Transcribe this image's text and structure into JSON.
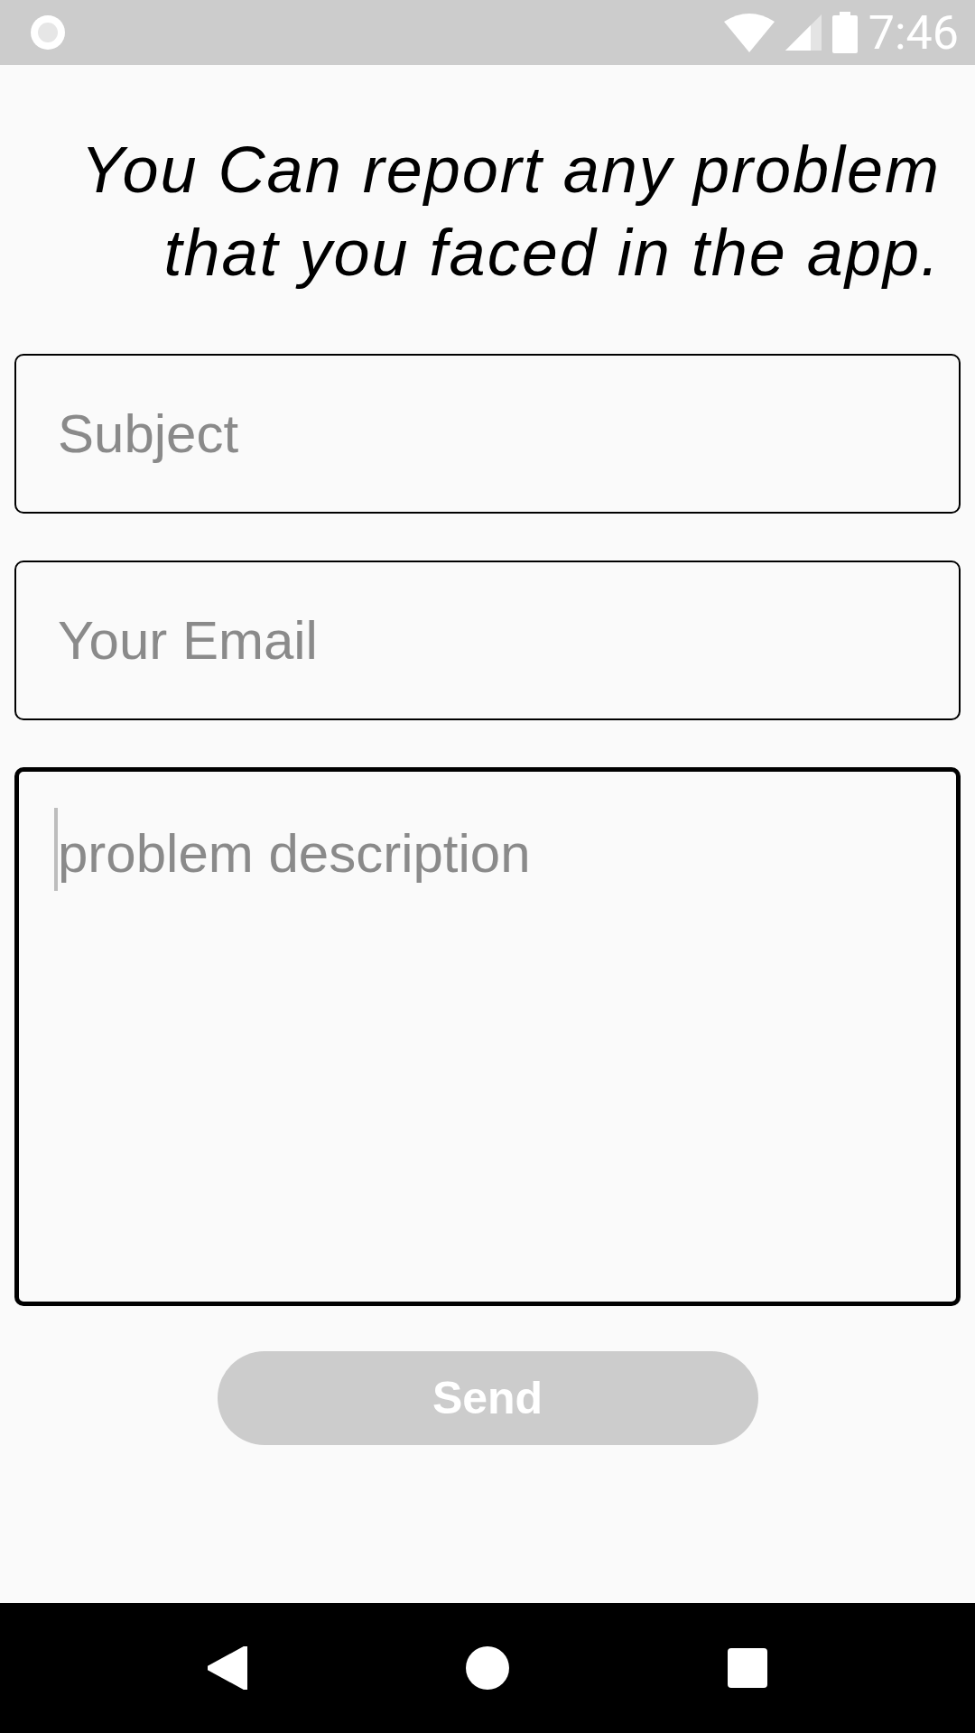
{
  "status_bar": {
    "time": "7:46"
  },
  "heading": "You Can report any problem that you faced in the app.",
  "fields": [
    {
      "kind": "line",
      "placeholder": "Subject",
      "focused": false
    },
    {
      "kind": "line",
      "placeholder": "Your Email",
      "focused": false
    },
    {
      "kind": "multiline",
      "placeholder": "problem description",
      "focused": true
    }
  ],
  "send_button": {
    "label": "Send",
    "disabled": true
  }
}
